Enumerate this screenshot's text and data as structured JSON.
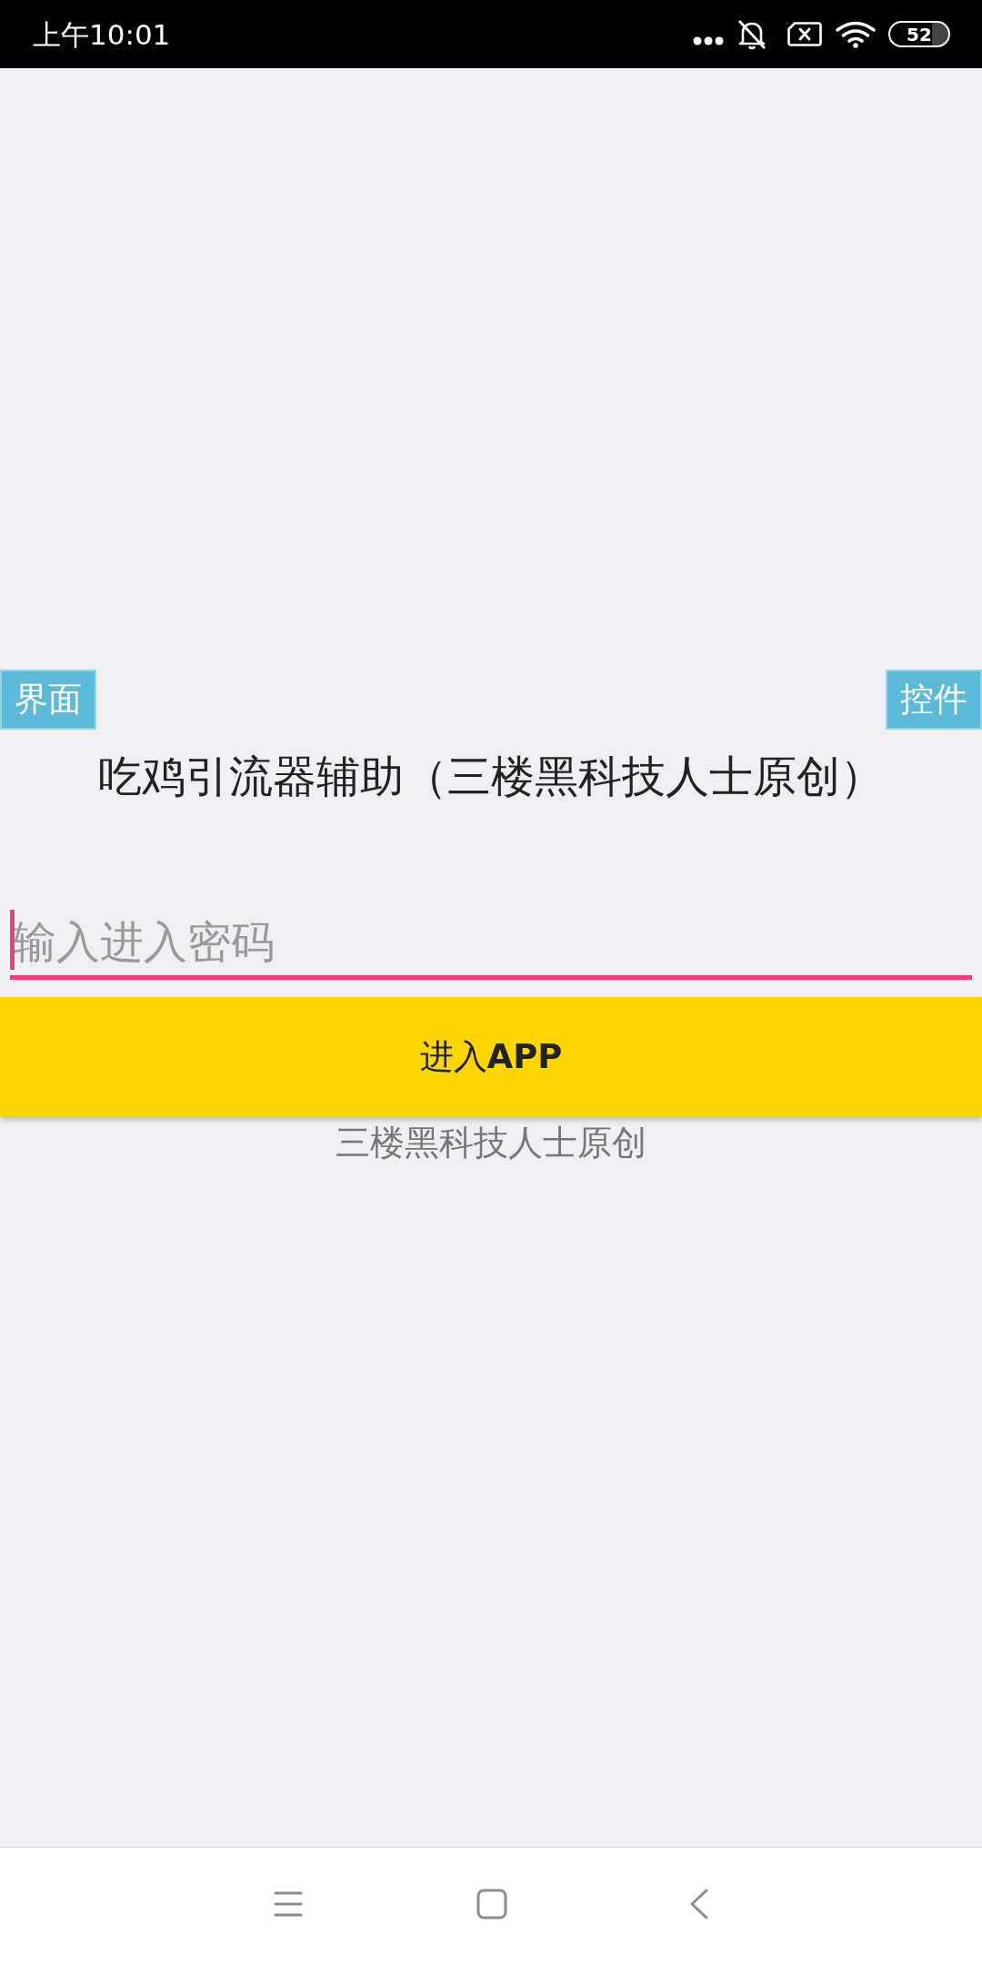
{
  "status_bar": {
    "time": "上午10:01",
    "battery": "52"
  },
  "tags": [
    {
      "label": "界面"
    },
    {
      "label": "控件"
    }
  ],
  "title": "吃鸡引流器辅助（三楼黑科技人士原创）",
  "password_field": {
    "placeholder": "输入进入密码",
    "focused": true
  },
  "enter_button": {
    "label": "进入**APP**"
  },
  "footer": "三楼黑科技人士原创"
}
